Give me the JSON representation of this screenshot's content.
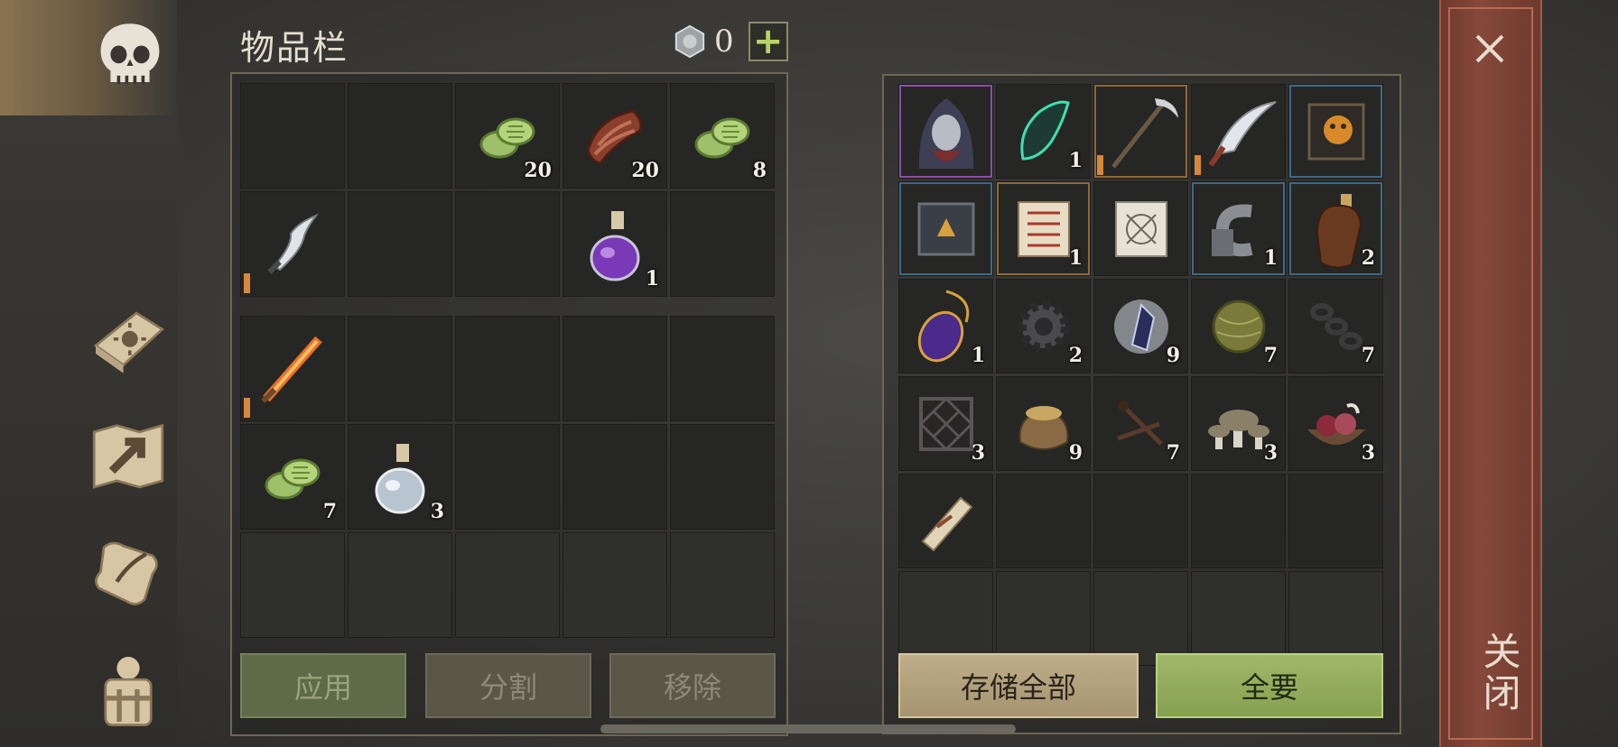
{
  "inventory": {
    "title": "物品栏",
    "currency_value": "0",
    "plus_label": "+",
    "grid_top": [
      {
        "icon": "empty"
      },
      {
        "icon": "empty"
      },
      {
        "icon": "herb-coins",
        "count": "20"
      },
      {
        "icon": "meat-slab",
        "count": "20"
      },
      {
        "icon": "herb-coins",
        "count": "8"
      },
      {
        "icon": "curved-dagger",
        "bar": true
      },
      {
        "icon": "empty"
      },
      {
        "icon": "empty"
      },
      {
        "icon": "purple-potion",
        "count": "1"
      },
      {
        "icon": "empty"
      }
    ],
    "grid_bottom": [
      {
        "icon": "flame-sword",
        "bar": true
      },
      {
        "icon": "empty"
      },
      {
        "icon": "empty"
      },
      {
        "icon": "empty"
      },
      {
        "icon": "empty"
      },
      {
        "icon": "herb-coins",
        "count": "7"
      },
      {
        "icon": "water-potion",
        "count": "3"
      },
      {
        "icon": "empty"
      },
      {
        "icon": "empty"
      },
      {
        "icon": "empty"
      },
      {
        "icon": "empty-light"
      },
      {
        "icon": "empty-light"
      },
      {
        "icon": "empty-light"
      },
      {
        "icon": "empty-light"
      },
      {
        "icon": "empty-light"
      }
    ],
    "buttons": {
      "apply": "应用",
      "split": "分割",
      "remove": "移除"
    }
  },
  "storage": {
    "grid": [
      {
        "icon": "hooded-figure",
        "frame": "purple"
      },
      {
        "icon": "green-crystal",
        "count": "1"
      },
      {
        "icon": "scythe",
        "frame": "orange",
        "bar": true
      },
      {
        "icon": "sickle",
        "bar": true
      },
      {
        "icon": "mask-book",
        "frame": "blue"
      },
      {
        "icon": "rune-book",
        "frame": "blue"
      },
      {
        "icon": "rune-scroll",
        "count": "1",
        "frame": "orange"
      },
      {
        "icon": "blueprint"
      },
      {
        "icon": "iron-clamp",
        "count": "1",
        "frame": "blue"
      },
      {
        "icon": "leather-flask",
        "count": "2",
        "frame": "blue"
      },
      {
        "icon": "purple-amulet",
        "count": "1"
      },
      {
        "icon": "gear",
        "count": "2"
      },
      {
        "icon": "dark-crystal",
        "count": "9"
      },
      {
        "icon": "straw-ball",
        "count": "7"
      },
      {
        "icon": "chain",
        "count": "7"
      },
      {
        "icon": "iron-grate",
        "count": "3"
      },
      {
        "icon": "grain-sack",
        "count": "9"
      },
      {
        "icon": "nails",
        "count": "7"
      },
      {
        "icon": "mushrooms",
        "count": "3"
      },
      {
        "icon": "meat-bowl",
        "count": "3"
      },
      {
        "icon": "paper-roll"
      },
      {
        "icon": "empty"
      },
      {
        "icon": "empty"
      },
      {
        "icon": "empty"
      },
      {
        "icon": "empty"
      },
      {
        "icon": "empty-light"
      },
      {
        "icon": "empty-light"
      },
      {
        "icon": "empty-light"
      },
      {
        "icon": "empty-light"
      },
      {
        "icon": "empty-light"
      }
    ],
    "buttons": {
      "store_all": "存储全部",
      "take_all": "全要"
    }
  },
  "close_label": "关闭",
  "sidebar": [
    "skull-icon",
    "sun-book-icon",
    "map-arrow-icon",
    "scroll-quill-icon",
    "backpack-icon"
  ],
  "colors": {
    "accent_green": "#9fb86a",
    "frame_orange": "#8e6a3a",
    "close_red": "#86483a"
  }
}
